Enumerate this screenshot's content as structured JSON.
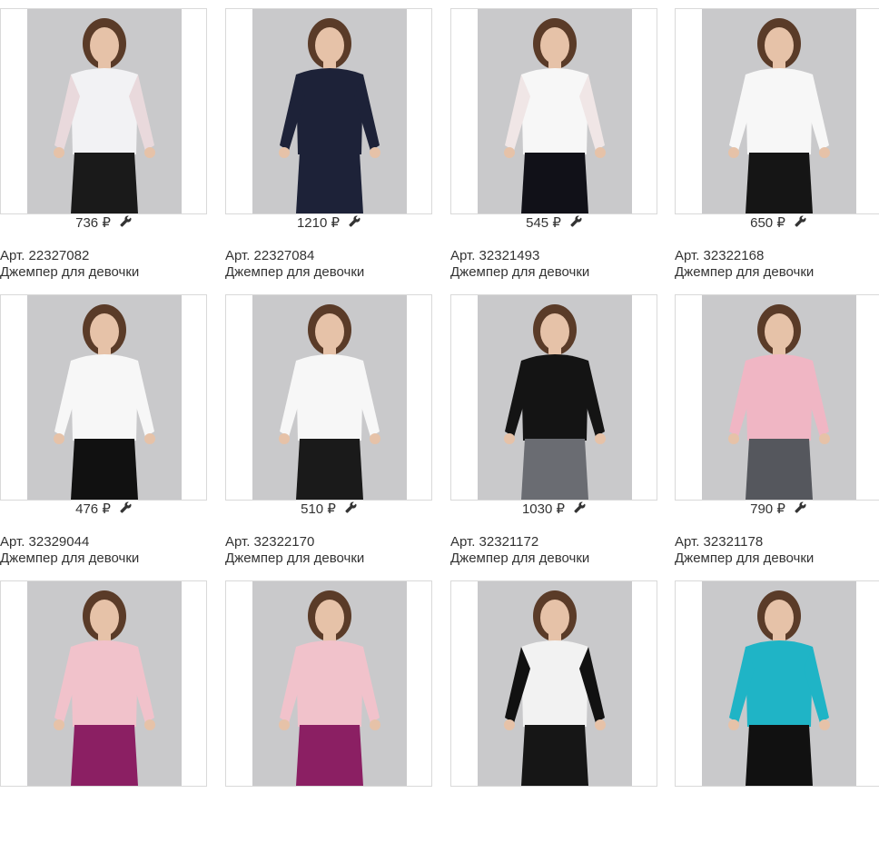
{
  "products": [
    {
      "price": "736 ₽",
      "sku": "Арт. 22327082",
      "name": "Джемпер для девочки",
      "image": "girl-white-lace-sweater",
      "top_color": "#f2f2f4",
      "sleeve_color": "#e9d9dc",
      "bottom_color": "#1a1a1a"
    },
    {
      "price": "1210 ₽",
      "sku": "Арт. 22327084",
      "name": "Джемпер для девочки",
      "image": "girl-navy-studded-sweater",
      "top_color": "#1d2238",
      "sleeve_color": "#1d2238",
      "bottom_color": "#1d2238"
    },
    {
      "price": "545 ₽",
      "sku": "Арт. 32321493",
      "name": "Джемпер для девочки",
      "image": "girl-white-blouse-tulle-skirt",
      "top_color": "#f7f7f7",
      "sleeve_color": "#f0e6e6",
      "bottom_color": "#111118"
    },
    {
      "price": "650 ₽",
      "sku": "Арт. 32322168",
      "name": "Джемпер для девочки",
      "image": "girl-white-puff-sleeve-top",
      "top_color": "#f7f7f7",
      "sleeve_color": "#f7f7f7",
      "bottom_color": "#151515"
    },
    {
      "price": "476 ₽",
      "sku": "Арт. 32329044",
      "name": "Джемпер для девочки",
      "image": "girl-white-ruffle-top",
      "top_color": "#f7f7f7",
      "sleeve_color": "#f7f7f7",
      "bottom_color": "#111111"
    },
    {
      "price": "510 ₽",
      "sku": "Арт. 32322170",
      "name": "Джемпер для девочки",
      "image": "girl-off-shoulder-ruffle-top",
      "top_color": "#f7f7f7",
      "sleeve_color": "#f7f7f7",
      "bottom_color": "#1a1a1a"
    },
    {
      "price": "1030 ₽",
      "sku": "Арт. 32321172",
      "name": "Джемпер для девочки",
      "image": "girl-graffiti-sweater",
      "top_color": "#141414",
      "sleeve_color": "#141414",
      "bottom_color": "#6a6c72"
    },
    {
      "price": "790 ₽",
      "sku": "Арт. 32321178",
      "name": "Джемпер для девочки",
      "image": "girl-pink-turtleneck",
      "top_color": "#f0b6c4",
      "sleeve_color": "#f0b6c4",
      "bottom_color": "#55575d"
    },
    {
      "price": "",
      "sku": "",
      "name": "",
      "image": "girl-pink-polka-dot-sweater",
      "top_color": "#f1c2cb",
      "sleeve_color": "#f1c2cb",
      "bottom_color": "#8b1f63"
    },
    {
      "price": "",
      "sku": "",
      "name": "",
      "image": "girl-pink-polka-dot-sweater-2",
      "top_color": "#f1c2cb",
      "sleeve_color": "#f1c2cb",
      "bottom_color": "#8b1f63"
    },
    {
      "price": "",
      "sku": "",
      "name": "",
      "image": "girl-houndstooth-sweater",
      "top_color": "#f2f2f2",
      "sleeve_color": "#111111",
      "bottom_color": "#161616"
    },
    {
      "price": "",
      "sku": "",
      "name": "",
      "image": "girl-zebra-turquoise-sweater",
      "top_color": "#1fb4c6",
      "sleeve_color": "#1fb4c6",
      "bottom_color": "#111111"
    }
  ],
  "icons": {
    "edit": "wrench-icon"
  }
}
